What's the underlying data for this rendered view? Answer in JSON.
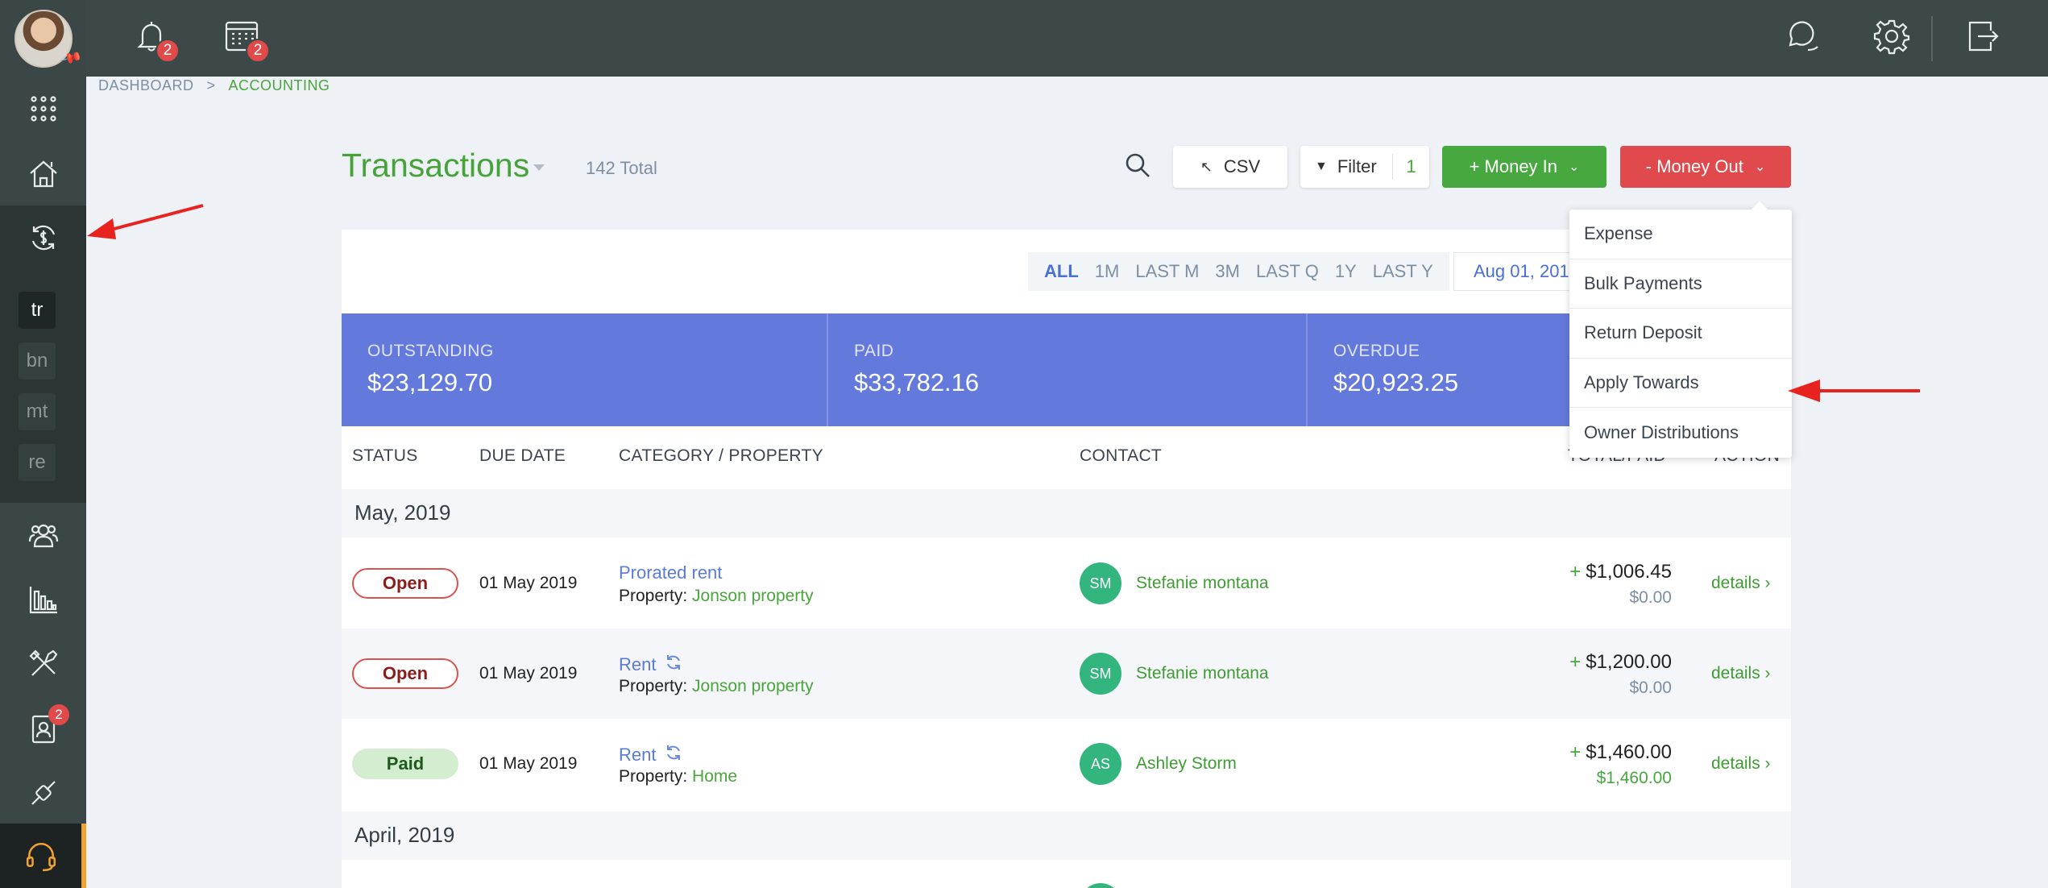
{
  "topbar": {
    "notifications_badge": "2",
    "calendar_badge": "2"
  },
  "sidebar": {
    "sub_items": [
      "tr",
      "bn",
      "mt",
      "re"
    ],
    "contacts_badge": "2"
  },
  "breadcrumb": {
    "items": [
      "DASHBOARD",
      "ACCOUNTING"
    ],
    "separator": ">"
  },
  "header": {
    "title": "Transactions",
    "total": "142 Total",
    "csv_label": "CSV",
    "filter_label": "Filter",
    "filter_count": "1",
    "money_in_label": "+ Money In",
    "money_out_label": "- Money Out"
  },
  "ranges": {
    "items": [
      "ALL",
      "1M",
      "LAST M",
      "3M",
      "LAST Q",
      "1Y",
      "LAST Y"
    ],
    "selected": "ALL",
    "date_from": "Aug 01, 201"
  },
  "summary": [
    {
      "label": "OUTSTANDING",
      "value": "$23,129.70"
    },
    {
      "label": "PAID",
      "value": "$33,782.16"
    },
    {
      "label": "OVERDUE",
      "value": "$20,923.25"
    }
  ],
  "table": {
    "headers": [
      "STATUS",
      "DUE DATE",
      "CATEGORY / PROPERTY",
      "CONTACT",
      "TOTAL/PAID",
      "ACTION"
    ],
    "groups": [
      {
        "month": "May, 2019",
        "rows": [
          {
            "status": "Open",
            "due": "01 May 2019",
            "category": "Prorated rent",
            "recurring": false,
            "property_label": "Property:",
            "property": "Jonson property",
            "initials": "SM",
            "contact": "Stefanie montana",
            "total": "$1,006.45",
            "paid": "$0.00",
            "action": "details ›"
          },
          {
            "status": "Open",
            "due": "01 May 2019",
            "category": "Rent",
            "recurring": true,
            "property_label": "Property:",
            "property": "Jonson property",
            "initials": "SM",
            "contact": "Stefanie montana",
            "total": "$1,200.00",
            "paid": "$0.00",
            "action": "details ›"
          },
          {
            "status": "Paid",
            "due": "01 May 2019",
            "category": "Rent",
            "recurring": true,
            "property_label": "Property:",
            "property": "Home",
            "initials": "AS",
            "contact": "Ashley Storm",
            "total": "$1,460.00",
            "paid": "$1,460.00",
            "action": "details ›"
          }
        ]
      },
      {
        "month": "April, 2019",
        "rows": []
      }
    ]
  },
  "money_out_menu": {
    "items": [
      "Expense",
      "Bulk Payments",
      "Return Deposit",
      "Apply Towards",
      "Owner Distributions"
    ]
  },
  "colors": {
    "accent_green": "#46a83e",
    "danger_red": "#e04a4c",
    "summary_blue": "#6479dc",
    "sidebar": "#3a4746"
  }
}
